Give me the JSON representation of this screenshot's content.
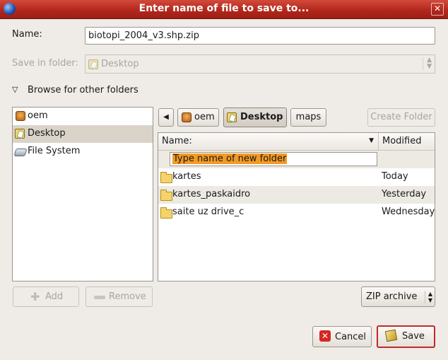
{
  "window": {
    "title": "Enter name of file to save to..."
  },
  "name": {
    "label": "Name:",
    "value": "biotopi_2004_v3.shp.zip"
  },
  "save_in": {
    "label": "Save in folder:",
    "value": "Desktop"
  },
  "browse": {
    "label": "Browse for other folders"
  },
  "places": [
    {
      "label": "oem",
      "icon": "home-icon"
    },
    {
      "label": "Desktop",
      "icon": "desktop-icon"
    },
    {
      "label": "File System",
      "icon": "harddisk-icon"
    }
  ],
  "path_bar": {
    "back": "◀",
    "crumbs": [
      "oem",
      "Desktop",
      "maps"
    ]
  },
  "create_folder": "Create Folder",
  "columns": {
    "name": "Name:",
    "modified": "Modified",
    "sort_arrow": "▼"
  },
  "new_folder_placeholder": "Type name of new folder",
  "files": [
    {
      "name": "kartes",
      "modified": "Today"
    },
    {
      "name": "kartes_paskaidro",
      "modified": "Yesterday"
    },
    {
      "name": "saite uz drive_c",
      "modified": "Wednesday"
    }
  ],
  "add_button": "Add",
  "remove_button": "Remove",
  "filter": {
    "value": "ZIP archive"
  },
  "cancel_button": "Cancel",
  "save_button": "Save",
  "colors": {
    "titlebar": "#b3271c",
    "selection": "#f39a24",
    "save_border": "#c0292a"
  }
}
